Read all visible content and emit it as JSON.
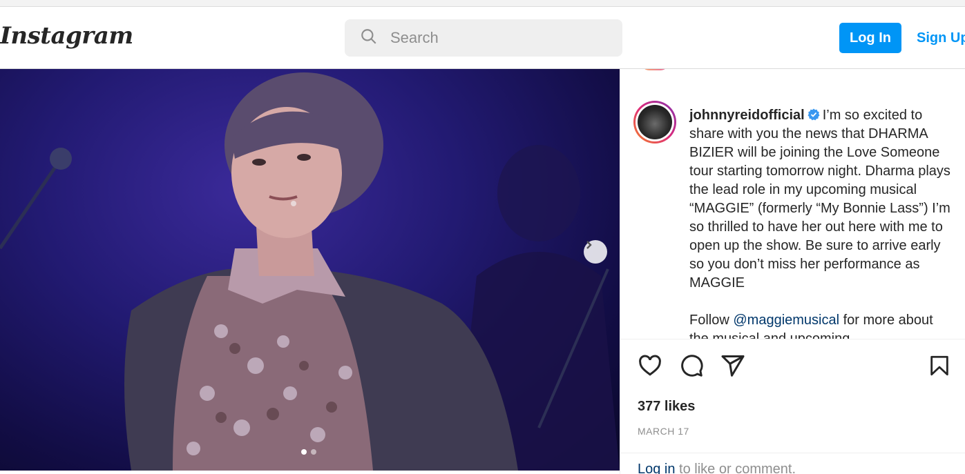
{
  "header": {
    "logo": "Instagram",
    "search_placeholder": "Search",
    "login_label": "Log In",
    "signup_label": "Sign Up"
  },
  "post": {
    "username": "johnnyreidofficial",
    "caption_main": "I’m so excited to share with you the news that DHARMA BIZIER will be joining the Love Someone tour starting tomorrow night. Dharma plays the lead role in my upcoming musical “MAGGIE” (formerly “My Bonnie Lass”) I’m so thrilled to have her out here with me to open up the show. Be sure to arrive early so you don’t miss her performance as MAGGIE",
    "follow_prefix": "Follow ",
    "mention": "@maggiemusical",
    "follow_suffix": " for more about the musical and upcoming",
    "likes": "377 likes",
    "date": "MARCH 17",
    "login_link": "Log in",
    "login_rest": " to like or comment."
  },
  "carousel": {
    "current": 1,
    "total": 2
  },
  "colors": {
    "accent": "#0095f6",
    "verified": "#3897f0",
    "link": "#00376b"
  },
  "icons": [
    "search-icon",
    "verified-icon",
    "next-arrow-icon",
    "heart-icon",
    "comment-icon",
    "share-icon",
    "bookmark-icon"
  ]
}
